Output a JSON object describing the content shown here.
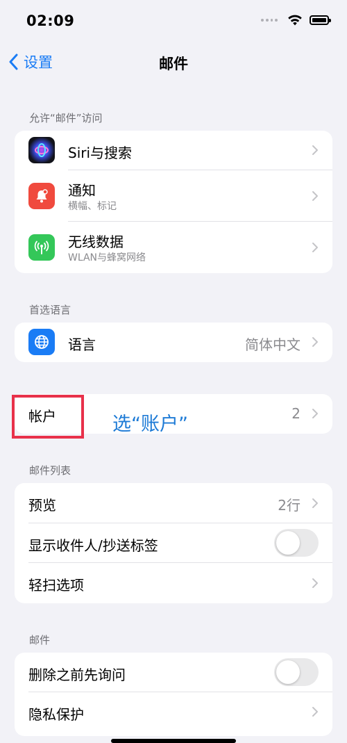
{
  "status": {
    "time": "02:09"
  },
  "nav": {
    "back_label": "设置",
    "title": "邮件"
  },
  "section_access": {
    "header": "允许“邮件”访问",
    "items": [
      {
        "label": "Siri与搜索",
        "icon": "siri-icon"
      },
      {
        "label": "通知",
        "sublabel": "横幅、标记",
        "icon": "bell-icon"
      },
      {
        "label": "无线数据",
        "sublabel": "WLAN与蜂窝网络",
        "icon": "antenna-icon"
      }
    ]
  },
  "section_language": {
    "header": "首选语言",
    "items": [
      {
        "label": "语言",
        "value": "简体中文",
        "icon": "globe-icon"
      }
    ]
  },
  "section_accounts": {
    "items": [
      {
        "label": "帐户",
        "value": "2"
      }
    ]
  },
  "annotation": {
    "text": "选“账户”"
  },
  "section_mail_list": {
    "header": "邮件列表",
    "items": [
      {
        "label": "预览",
        "value": "2行"
      },
      {
        "label": "显示收件人/抄送标签",
        "toggle_on": false
      },
      {
        "label": "轻扫选项"
      }
    ]
  },
  "section_mail": {
    "header": "邮件",
    "items": [
      {
        "label": "删除之前先询问",
        "toggle_on": false
      },
      {
        "label": "隐私保护"
      }
    ]
  },
  "colors": {
    "accent": "#1a7cf5",
    "annotation_red": "#e8314a",
    "annotation_blue": "#1e7bd6",
    "notify_icon_bg": "#f04a3e",
    "data_icon_bg": "#34c759",
    "language_icon_bg": "#1a7cf5"
  }
}
